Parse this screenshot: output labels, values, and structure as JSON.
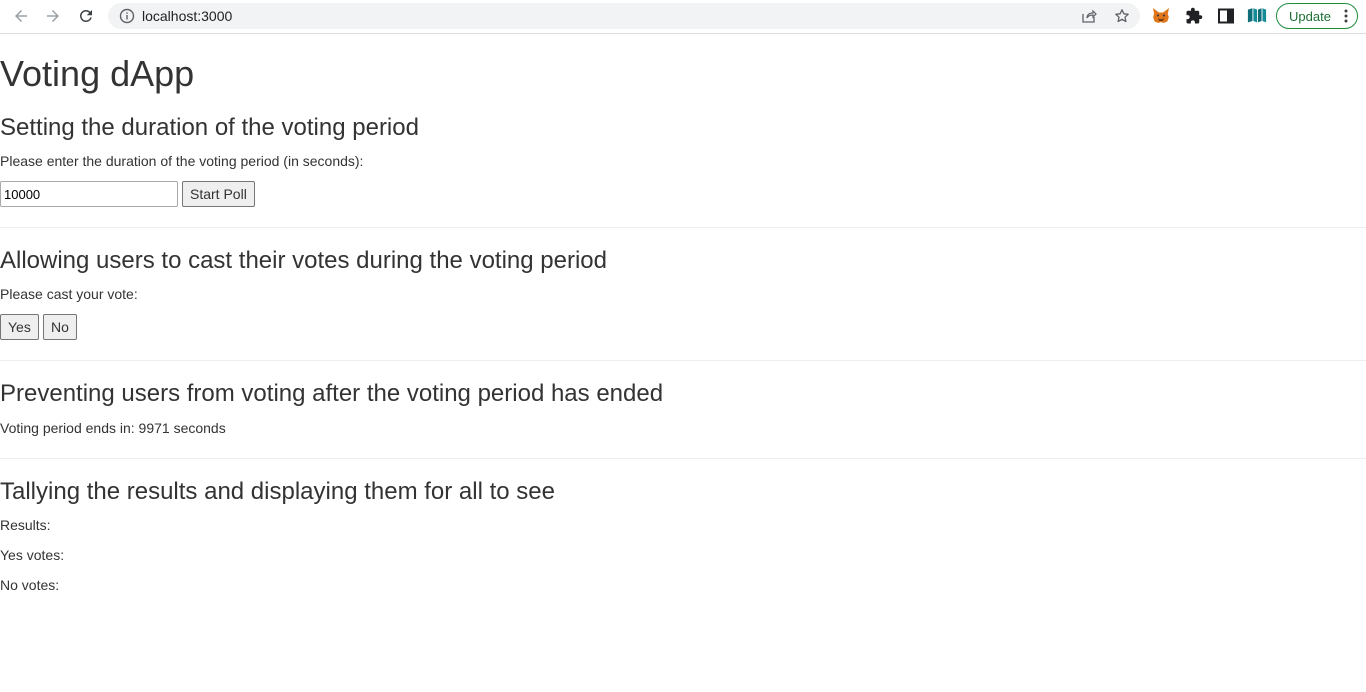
{
  "browser": {
    "url": "localhost:3000",
    "update_label": "Update",
    "icons": [
      "back-icon",
      "forward-icon",
      "reload-icon",
      "info-icon",
      "share-icon",
      "star-icon",
      "metamask-fox-icon",
      "puzzle-extensions-icon",
      "side-panel-icon",
      "reading-list-icon",
      "more-vert-icon"
    ]
  },
  "app": {
    "title": "Voting dApp"
  },
  "duration": {
    "heading": "Setting the duration of the voting period",
    "prompt": "Please enter the duration of the voting period (in seconds):",
    "input_value": "10000",
    "start_button": "Start Poll"
  },
  "vote": {
    "heading": "Allowing users to cast their votes during the voting period",
    "prompt": "Please cast your vote:",
    "yes_button": "Yes",
    "no_button": "No"
  },
  "timer": {
    "heading": "Preventing users from voting after the voting period has ended",
    "status": "Voting period ends in: 9971 seconds"
  },
  "results": {
    "heading": "Tallying the results and displaying them for all to see",
    "label": "Results:",
    "yes_label": "Yes votes:",
    "no_label": "No votes:"
  },
  "colors": {
    "text": "#333333",
    "update_border": "#1e8e3e",
    "omnibox_bg": "#f1f3f4"
  }
}
